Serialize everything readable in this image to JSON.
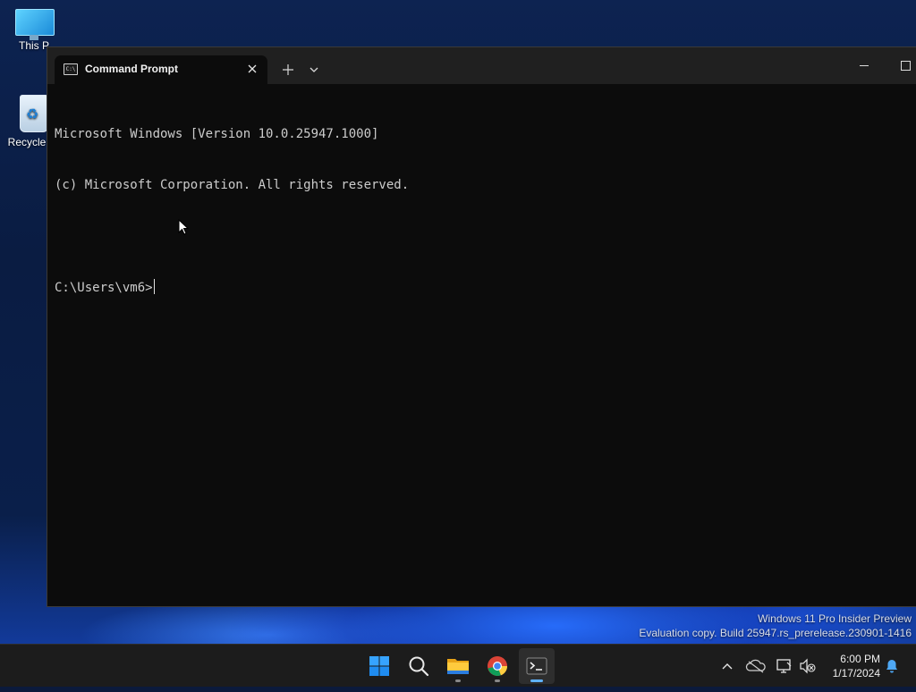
{
  "desktop": {
    "icons": [
      {
        "label": "This P",
        "icon": "this-pc-icon"
      },
      {
        "label": "Recycle",
        "icon": "recycle-bin-icon"
      }
    ],
    "watermark": {
      "line1": "Windows 11 Pro Insider Preview",
      "line2": "Evaluation copy. Build 25947.rs_prerelease.230901-1416"
    }
  },
  "terminal": {
    "tab_title": "Command Prompt",
    "tab_icon": "cmd-icon",
    "new_tab_symbol": "+",
    "dropdown_symbol": "⌄",
    "console_lines": [
      "Microsoft Windows [Version 10.0.25947.1000]",
      "(c) Microsoft Corporation. All rights reserved.",
      "",
      "C:\\Users\\vm6>"
    ]
  },
  "taskbar": {
    "apps": [
      {
        "name": "start",
        "icon": "windows-logo-icon"
      },
      {
        "name": "search",
        "icon": "search-icon"
      },
      {
        "name": "file-explorer",
        "icon": "folder-icon"
      },
      {
        "name": "chrome",
        "icon": "chrome-icon"
      },
      {
        "name": "terminal",
        "icon": "terminal-icon",
        "active": true
      }
    ],
    "tray_icons": [
      "chevron-up-icon",
      "onedrive-icon",
      "network-icon",
      "volume-muted-icon"
    ],
    "clock": {
      "time": "6:00 PM",
      "date": "1/17/2024"
    },
    "notification_icon": "bell-icon"
  },
  "colors": {
    "console_bg": "#0c0c0c",
    "titlebar_bg": "#202020",
    "taskbar_bg": "#1c1c1c",
    "accent": "#5fb2ff"
  }
}
